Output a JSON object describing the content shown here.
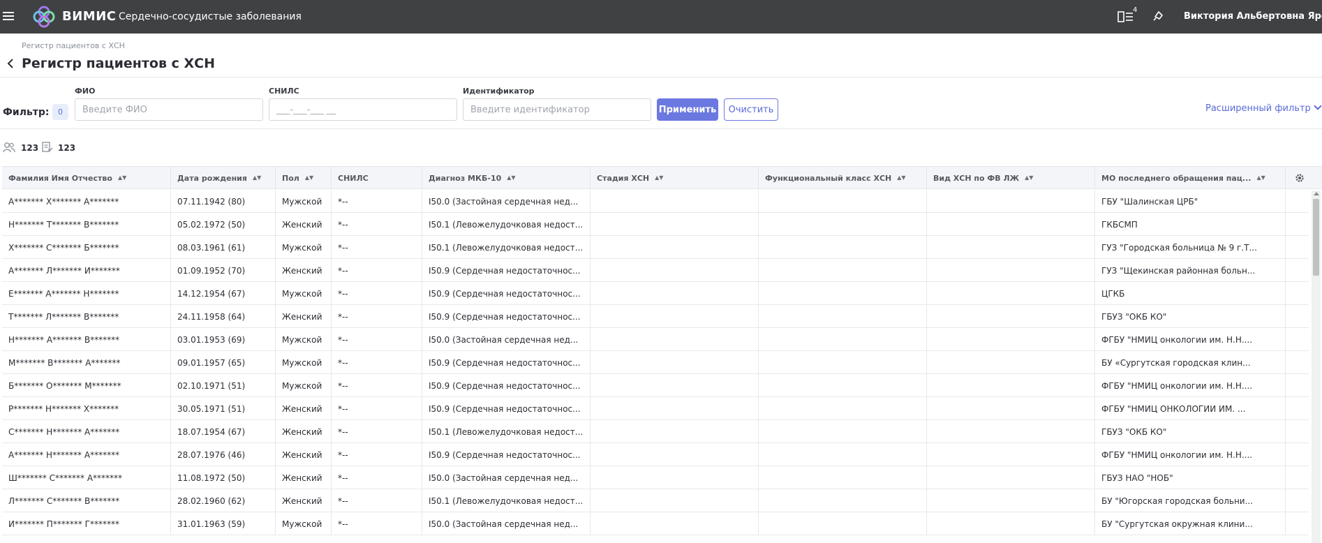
{
  "header": {
    "brand": "ВИМИС",
    "subtitle": "Сердечно-сосудистые заболевания",
    "tasks_badge": "4",
    "user_name": "Виктория Альбертовна Яровая"
  },
  "breadcrumb": "Регистр пациентов с ХСН",
  "page_title": "Регистр пациентов с ХСН",
  "filter": {
    "label": "Фильтр:",
    "count": "0",
    "fio_label": "ФИО",
    "fio_placeholder": "Введите ФИО",
    "snils_label": "СНИЛС",
    "snils_placeholder": "___-___-___ __",
    "id_label": "Идентификатор",
    "id_placeholder": "Введите идентификатор",
    "apply": "Применить",
    "clear": "Очистить",
    "advanced": "Расширенный фильтр"
  },
  "counters": {
    "patients": "123",
    "records": "123"
  },
  "table": {
    "columns": [
      "Фамилия Имя Отчество",
      "Дата рождения",
      "Пол",
      "СНИЛС",
      "Диагноз МКБ-10",
      "Стадия ХСН",
      "Функциональный класс ХСН",
      "Вид ХСН по ФВ ЛЖ",
      "МО последнего обращения пац..."
    ],
    "rows": [
      [
        "А******* Х******* А*******",
        "07.11.1942 (80)",
        "Мужской",
        "*--",
        "I50.0 (Застойная сердечная нед...",
        "",
        "",
        "",
        "ГБУ \"Шалинская ЦРБ\""
      ],
      [
        "Н******* Т******* В*******",
        "05.02.1972 (50)",
        "Женский",
        "*--",
        "I50.1 (Левожелудочковая недост...",
        "",
        "",
        "",
        "ГКБСМП"
      ],
      [
        "Х******* С******* Б*******",
        "08.03.1961 (61)",
        "Мужской",
        "*--",
        "I50.1 (Левожелудочковая недост...",
        "",
        "",
        "",
        "ГУЗ \"Городская больница № 9 г.Т..."
      ],
      [
        "А******* Л******* И*******",
        "01.09.1952 (70)",
        "Женский",
        "*--",
        "I50.9 (Сердечная недостаточнос...",
        "",
        "",
        "",
        "ГУЗ \"Щекинская районная больн..."
      ],
      [
        "Е******* А******* Н*******",
        "14.12.1954 (67)",
        "Мужской",
        "*--",
        "I50.9 (Сердечная недостаточнос...",
        "",
        "",
        "",
        "ЦГКБ"
      ],
      [
        "Т******* Л******* В*******",
        "24.11.1958 (64)",
        "Женский",
        "*--",
        "I50.9 (Сердечная недостаточнос...",
        "",
        "",
        "",
        "ГБУЗ \"ОКБ КО\""
      ],
      [
        "Н******* А******* В*******",
        "03.01.1953 (69)",
        "Мужской",
        "*--",
        "I50.0 (Застойная сердечная нед...",
        "",
        "",
        "",
        "ФГБУ \"НМИЦ онкологии им. Н.Н...."
      ],
      [
        "М******* В******* А*******",
        "09.01.1957 (65)",
        "Мужской",
        "*--",
        "I50.9 (Сердечная недостаточнос...",
        "",
        "",
        "",
        "БУ «Сургутская городская клин..."
      ],
      [
        "Б******* О******* М*******",
        "02.10.1971 (51)",
        "Мужской",
        "*--",
        "I50.9 (Сердечная недостаточнос...",
        "",
        "",
        "",
        "ФГБУ \"НМИЦ онкологии им. Н.Н...."
      ],
      [
        "Р******* Н******* Х*******",
        "30.05.1971 (51)",
        "Женский",
        "*--",
        "I50.9 (Сердечная недостаточнос...",
        "",
        "",
        "",
        "ФГБУ \"НМИЦ ОНКОЛОГИИ ИМ. ..."
      ],
      [
        "С******* Н******* А*******",
        "18.07.1954 (67)",
        "Женский",
        "*--",
        "I50.1 (Левожелудочковая недост...",
        "",
        "",
        "",
        "ГБУЗ \"ОКБ КО\""
      ],
      [
        "А******* Н******* А*******",
        "28.07.1976 (46)",
        "Женский",
        "*--",
        "I50.9 (Сердечная недостаточнос...",
        "",
        "",
        "",
        "ФГБУ \"НМИЦ онкологии им. Н.Н...."
      ],
      [
        "Ш******* С******* А*******",
        "11.08.1972 (50)",
        "Женский",
        "*--",
        "I50.0 (Застойная сердечная нед...",
        "",
        "",
        "",
        "ГБУЗ НАО \"НОБ\""
      ],
      [
        "Л******* С******* В*******",
        "28.02.1960 (62)",
        "Женский",
        "*--",
        "I50.1 (Левожелудочковая недост...",
        "",
        "",
        "",
        "БУ \"Югорская городская больни..."
      ],
      [
        "И******* П******* Г*******",
        "31.01.1963 (59)",
        "Мужской",
        "*--",
        "I50.0 (Застойная сердечная нед...",
        "",
        "",
        "",
        "БУ \"Сургутская окружная клини..."
      ]
    ]
  },
  "colors": {
    "topbar": "#3f4143",
    "accent": "#6b78e0"
  }
}
